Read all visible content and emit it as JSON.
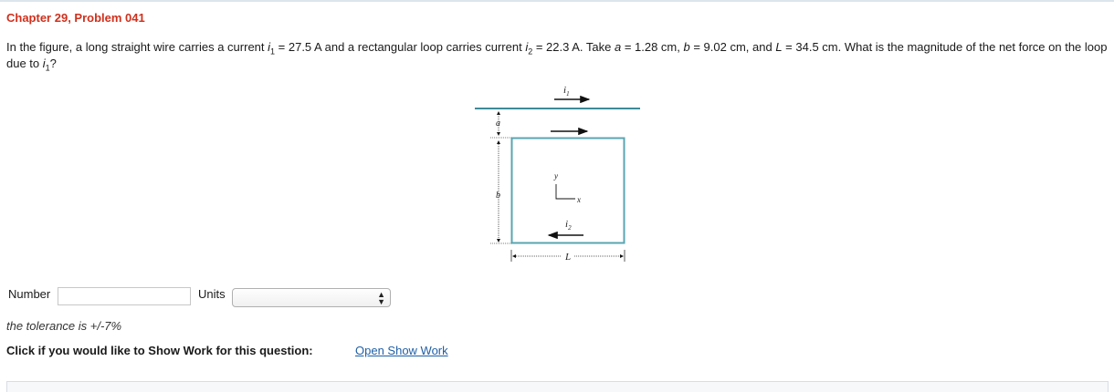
{
  "header": {
    "title": "Chapter 29, Problem 041"
  },
  "problem": {
    "t1": "In the figure, a long straight wire carries a current ",
    "i_sym": "i",
    "sub1": "1",
    "t2": " = 27.5 A and a rectangular loop carries current ",
    "sub2": "2",
    "t3": " = 22.3 A. Take ",
    "a_sym": "a",
    "t4": " = 1.28 cm, ",
    "b_sym": "b",
    "t5": " = 9.02 cm, and ",
    "L_sym": "L",
    "t6": " = 34.5 cm. What is the magnitude of the net force on the loop due to ",
    "t7": "?"
  },
  "figure": {
    "i1_label": "i",
    "i1_sub": "1",
    "i2_label": "i",
    "i2_sub": "2",
    "a_label": "a",
    "b_label": "b",
    "L_label": "L",
    "x_label": "x",
    "y_label": "y",
    "colors": {
      "wire": "#3e8b97",
      "loop": "#5aa5b0",
      "arrow": "#111111"
    }
  },
  "answer": {
    "number_label": "Number",
    "number_value": "",
    "units_label": "Units",
    "units_selected": ""
  },
  "tolerance": "the tolerance is +/-7%",
  "show_work": {
    "prompt": "Click if you would like to Show Work for this question:",
    "link": "Open Show Work"
  }
}
